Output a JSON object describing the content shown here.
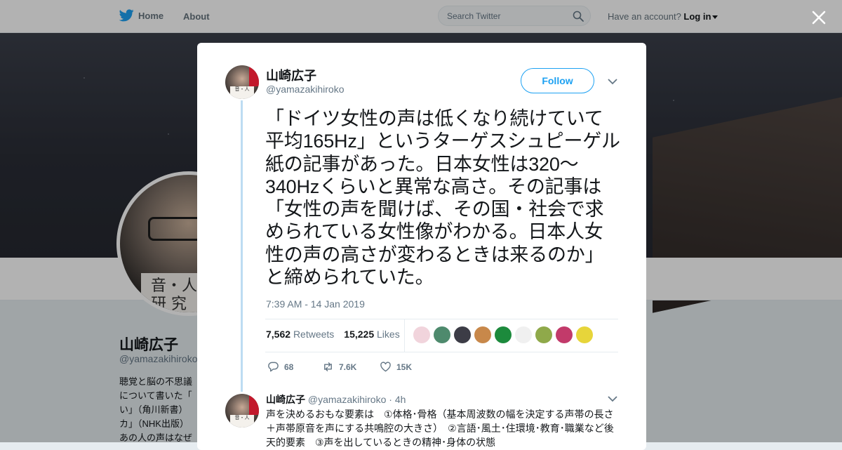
{
  "nav": {
    "home_label": "Home",
    "about_label": "About",
    "search_placeholder": "Search Twitter",
    "account_prompt": "Have an account?",
    "login_label": "Log in"
  },
  "profile": {
    "name": "山崎広子",
    "handle": "@yamazakihiroko",
    "avatar_text": "音・人\n研 究",
    "bio": "聴覚と脳の不思議\nについて書いた「\nい」（角川新書）\nカ」（NHK出版）\nあの人の声はなぜ"
  },
  "tweet": {
    "author_name": "山崎広子",
    "author_handle": "@yamazakihiroko",
    "follow_label": "Follow",
    "text": "「ドイツ女性の声は低くなり続けていて平均165Hz」というターゲスシュピーゲル紙の記事があった。日本女性は320～340Hzくらいと異常な高さ。その記事は「女性の声を聞けば、その国・社会で求められている女性像がわかる。日本人女性の声の高さが変わるときは来るのか」と締められていた。",
    "timestamp": "7:39 AM - 14 Jan 2019",
    "retweets_count": "7,562",
    "retweets_label": "Retweets",
    "likes_count": "15,225",
    "likes_label": "Likes",
    "replies_count": "68",
    "retweet_action_count": "7.6K",
    "like_action_count": "15K",
    "avatar_tag": "音・人"
  },
  "reply": {
    "author_name": "山崎広子",
    "author_handle": "@yamazakihiroko",
    "separator": "·",
    "age": "4h",
    "text": "声を決めるおもな要素は　①体格･骨格（基本周波数の幅を決定する声帯の長さ＋声帯原音を声にする共鳴腔の大きさ）　②言語･風土･住環境･教育･職業など後天的要素　③声を出しているときの精神･身体の状態"
  },
  "liker_avatars": [
    {
      "name": "liker-avatar-1",
      "color": "#f1d4dc"
    },
    {
      "name": "liker-avatar-2",
      "color": "#4e8a6d"
    },
    {
      "name": "liker-avatar-3",
      "color": "#3c3c46"
    },
    {
      "name": "liker-avatar-4",
      "color": "#c8884a"
    },
    {
      "name": "liker-avatar-5",
      "color": "#1c8a3c"
    },
    {
      "name": "liker-avatar-6",
      "color": "#f0f0f0"
    },
    {
      "name": "liker-avatar-7",
      "color": "#8fa94a"
    },
    {
      "name": "liker-avatar-8",
      "color": "#c23a6a"
    },
    {
      "name": "liker-avatar-9",
      "color": "#e7d53a"
    }
  ],
  "colors": {
    "accent": "#1da1f2",
    "muted": "#657786",
    "thread_line": "#bddcf2"
  },
  "icons": [
    "twitter-bird-icon",
    "search-icon",
    "close-icon",
    "chevron-down-icon",
    "reply-icon",
    "retweet-icon",
    "heart-icon"
  ]
}
